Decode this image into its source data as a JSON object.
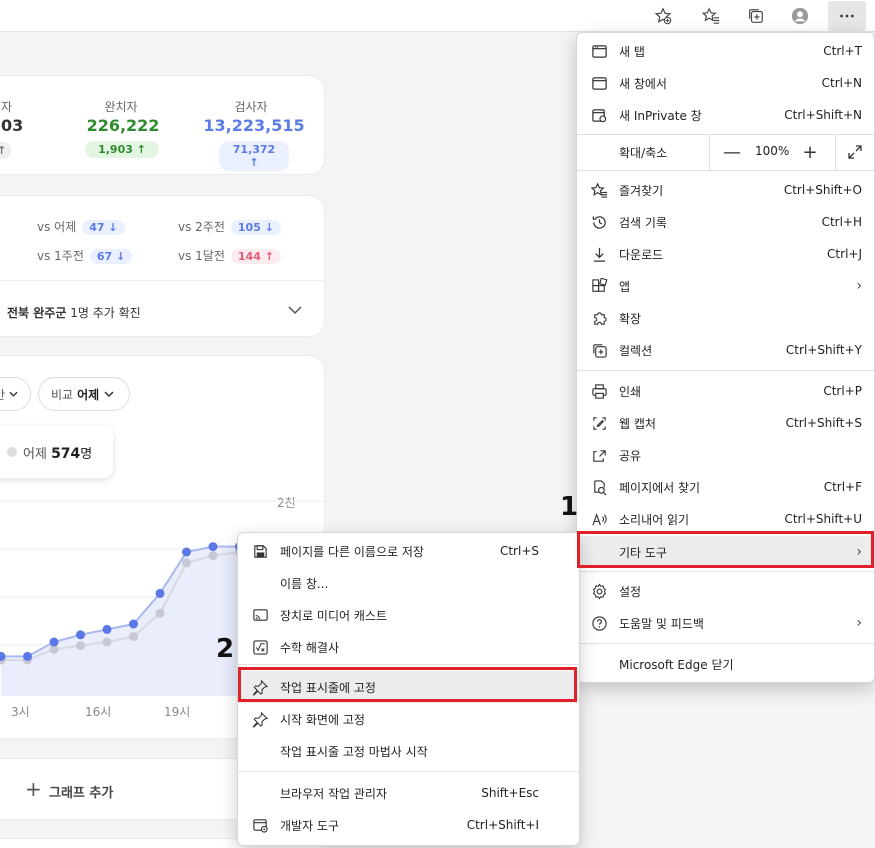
{
  "toolbar": {
    "buttons": [
      "favorites-add-icon",
      "favorites-icon",
      "collections-icon",
      "profile-icon",
      "more-icon"
    ]
  },
  "stats": {
    "first_label": "자",
    "first_value": "03",
    "recovered_label": "완치자",
    "recovered_value": "226,222",
    "recovered_delta": "1,903",
    "tested_label": "검사자",
    "tested_value": "13,223,515",
    "tested_delta": "71,372"
  },
  "compare": {
    "yesterday_label": "vs 어제",
    "yesterday_value": "47",
    "week1_label": "vs 1주전",
    "week1_value": "67",
    "week2_label": "vs 2주전",
    "week2_value": "105",
    "month1_label": "vs 1달전",
    "month1_value": "144",
    "news_region": "전북 완주군",
    "news_text": "1명 추가 확진"
  },
  "chart": {
    "chip_compare_prefix": "비교",
    "chip_compare_value": "어제",
    "yesterday_prefix": "어제",
    "yesterday_value": "574",
    "yesterday_unit": "명",
    "y_tick": "2천",
    "x_ticks": [
      "3시",
      "16시",
      "19시"
    ],
    "add_graph": "그래프 추가"
  },
  "chart_data": {
    "type": "area",
    "series": [
      {
        "values": [
          0.22,
          0.22,
          0.3,
          0.34,
          0.37,
          0.4,
          0.57,
          0.8,
          0.83,
          0.83,
          0.86
        ]
      },
      {
        "values": [
          0.2,
          0.2,
          0.26,
          0.28,
          0.3,
          0.33,
          0.46,
          0.74,
          0.78,
          0.8,
          0.83
        ]
      }
    ]
  },
  "main_menu": {
    "items": [
      {
        "label": "새 탭",
        "shortcut": "Ctrl+T",
        "icon": "new-tab-icon"
      },
      {
        "label": "새 창에서",
        "shortcut": "Ctrl+N",
        "icon": "new-window-icon"
      },
      {
        "label": "새 InPrivate 창",
        "shortcut": "Ctrl+Shift+N",
        "icon": "inprivate-icon"
      },
      {
        "label": "즐겨찾기",
        "shortcut": "Ctrl+Shift+O",
        "icon": "favorites-icon"
      },
      {
        "label": "검색 기록",
        "shortcut": "Ctrl+H",
        "icon": "history-icon"
      },
      {
        "label": "다운로드",
        "shortcut": "Ctrl+J",
        "icon": "download-icon"
      },
      {
        "label": "앱",
        "shortcut": "",
        "icon": "apps-icon"
      },
      {
        "label": "확장",
        "shortcut": "",
        "icon": "extensions-icon"
      },
      {
        "label": "컬렉션",
        "shortcut": "Ctrl+Shift+Y",
        "icon": "collections-icon"
      },
      {
        "label": "인쇄",
        "shortcut": "Ctrl+P",
        "icon": "print-icon"
      },
      {
        "label": "웹 캡처",
        "shortcut": "Ctrl+Shift+S",
        "icon": "web-capture-icon"
      },
      {
        "label": "공유",
        "shortcut": "",
        "icon": "share-icon"
      },
      {
        "label": "페이지에서 찾기",
        "shortcut": "Ctrl+F",
        "icon": "find-icon"
      },
      {
        "label": "소리내어 읽기",
        "shortcut": "Ctrl+Shift+U",
        "icon": "read-aloud-icon"
      },
      {
        "label": "기타 도구",
        "shortcut": "",
        "icon": ""
      },
      {
        "label": "설정",
        "shortcut": "",
        "icon": "settings-icon"
      },
      {
        "label": "도움말 및 피드백",
        "shortcut": "",
        "icon": "help-icon"
      },
      {
        "label": "Microsoft Edge 닫기",
        "shortcut": "",
        "icon": ""
      }
    ],
    "zoom_label": "확대/축소",
    "zoom_value": "100%"
  },
  "sub_menu": {
    "items": [
      {
        "label": "페이지를 다른 이름으로 저장",
        "shortcut": "Ctrl+S",
        "icon": "save-icon"
      },
      {
        "label": "이름 창...",
        "shortcut": "",
        "icon": ""
      },
      {
        "label": "장치로 미디어 캐스트",
        "shortcut": "",
        "icon": "cast-icon"
      },
      {
        "label": "수학 해결사",
        "shortcut": "",
        "icon": "math-solver-icon"
      },
      {
        "label": "작업 표시줄에 고정",
        "shortcut": "",
        "icon": "pin-icon"
      },
      {
        "label": "시작 화면에 고정",
        "shortcut": "",
        "icon": "pin-icon"
      },
      {
        "label": "작업 표시줄 고정 마법사 시작",
        "shortcut": "",
        "icon": ""
      },
      {
        "label": "브라우저 작업 관리자",
        "shortcut": "Shift+Esc",
        "icon": ""
      },
      {
        "label": "개발자 도구",
        "shortcut": "Ctrl+Shift+I",
        "icon": "devtools-icon"
      }
    ]
  },
  "annotations": {
    "step1": "1",
    "step2": "2"
  },
  "colors": {
    "highlight_box": "#e0202a",
    "recovered": "#2e8b2e",
    "tested": "#5b7ce6",
    "chart_line": "#5a78e6"
  }
}
